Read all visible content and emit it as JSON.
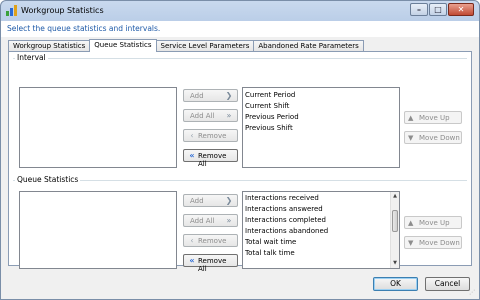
{
  "window": {
    "title": "Workgroup Statistics"
  },
  "subtitle": "Select the queue statistics and intervals.",
  "tabs": [
    {
      "label": "Workgroup Statistics"
    },
    {
      "label": "Queue Statistics"
    },
    {
      "label": "Service Level Parameters"
    },
    {
      "label": "Abandoned Rate Parameters"
    }
  ],
  "interval": {
    "label": "Interval",
    "selected": [
      "Current Period",
      "Current Shift",
      "Previous Period",
      "Previous Shift"
    ]
  },
  "queue_stats": {
    "label": "Queue Statistics",
    "selected": [
      "Interactions received",
      "Interactions answered",
      "Interactions completed",
      "Interactions abandoned",
      "Total wait time",
      "Total talk time"
    ]
  },
  "buttons": {
    "add": "Add",
    "add_all": "Add All",
    "remove": "Remove",
    "remove_all": "Remove All",
    "move_up": "Move Up",
    "move_down": "Move Down",
    "ok": "OK",
    "cancel": "Cancel"
  },
  "colors": {
    "link_blue": "#1e5aa8",
    "accent": "#2a6bd6"
  }
}
